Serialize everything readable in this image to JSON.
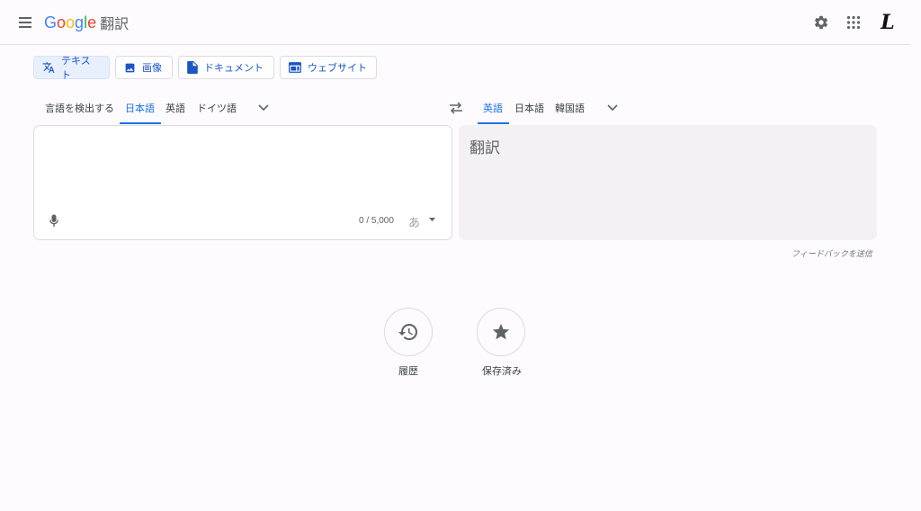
{
  "header": {
    "logo_letters": [
      "G",
      "o",
      "o",
      "g",
      "l",
      "e"
    ],
    "product_name": "翻訳",
    "avatar_letter": "L"
  },
  "modes": [
    {
      "label": "テキスト",
      "icon": "translate-icon",
      "active": true
    },
    {
      "label": "画像",
      "icon": "image-icon",
      "active": false
    },
    {
      "label": "ドキュメント",
      "icon": "document-icon",
      "active": false
    },
    {
      "label": "ウェブサイト",
      "icon": "website-icon",
      "active": false
    }
  ],
  "source_langs": {
    "detect": "言語を検出する",
    "items": [
      "日本語",
      "英語",
      "ドイツ語"
    ],
    "selected": "日本語"
  },
  "target_langs": {
    "items": [
      "英語",
      "日本語",
      "韓国語"
    ],
    "selected": "英語"
  },
  "source": {
    "char_count": "0 / 5,000",
    "ime_label": "あ"
  },
  "target": {
    "placeholder": "翻訳"
  },
  "feedback_link": "フィードバックを送信",
  "bottom_actions": [
    {
      "label": "履歴",
      "icon": "history-icon"
    },
    {
      "label": "保存済み",
      "icon": "star-icon"
    }
  ],
  "colors": {
    "accent": "#1a73e8",
    "chip_active_bg": "#e8f0fe",
    "target_panel_bg": "#f3f1f4"
  }
}
